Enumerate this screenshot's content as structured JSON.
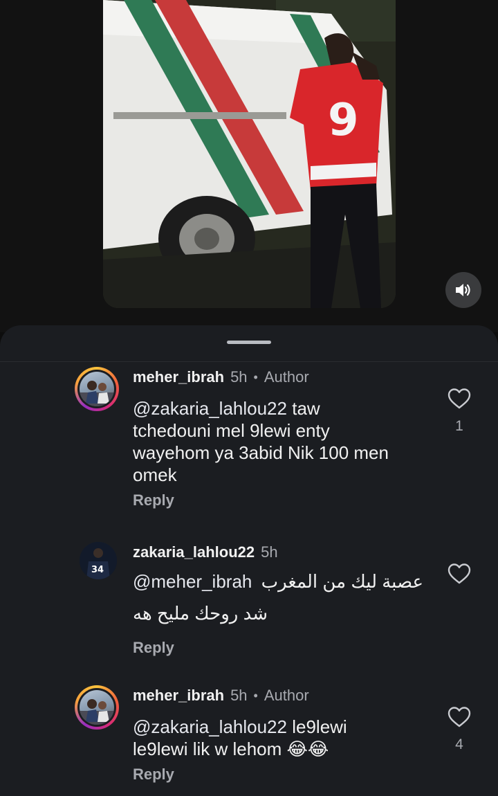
{
  "video": {
    "jersey_number": "9",
    "sound_icon": "speaker-icon"
  },
  "comments": [
    {
      "username": "meher_ibrah",
      "time": "5h",
      "separator": "•",
      "badge": "Author",
      "mention": "@zakaria_lahlou22",
      "text_lines": [
        "taw",
        "tchedouni mel 9lewi enty",
        "wayehom ya 3abid Nik 100 men",
        "omek"
      ],
      "reply_label": "Reply",
      "likes": "1"
    },
    {
      "username": "zakaria_lahlou22",
      "time": "5h",
      "mention": "@meher_ibrah",
      "line1_arabic": "عصبة ليك من المغرب",
      "line2_arabic": "شد روحك مليح هه",
      "avatar_number": "34",
      "reply_label": "Reply",
      "likes": ""
    },
    {
      "username": "meher_ibrah",
      "time": "5h",
      "separator": "•",
      "badge": "Author",
      "mention": "@zakaria_lahlou22",
      "text_lines": [
        "le9lewi",
        "le9lewi lik w lehom 😂😂"
      ],
      "reply_label": "Reply",
      "likes": "4"
    }
  ],
  "colors": {
    "sheet_bg": "#1b1d21",
    "text_primary": "#f1f1f1",
    "text_secondary": "#a8aab0"
  }
}
